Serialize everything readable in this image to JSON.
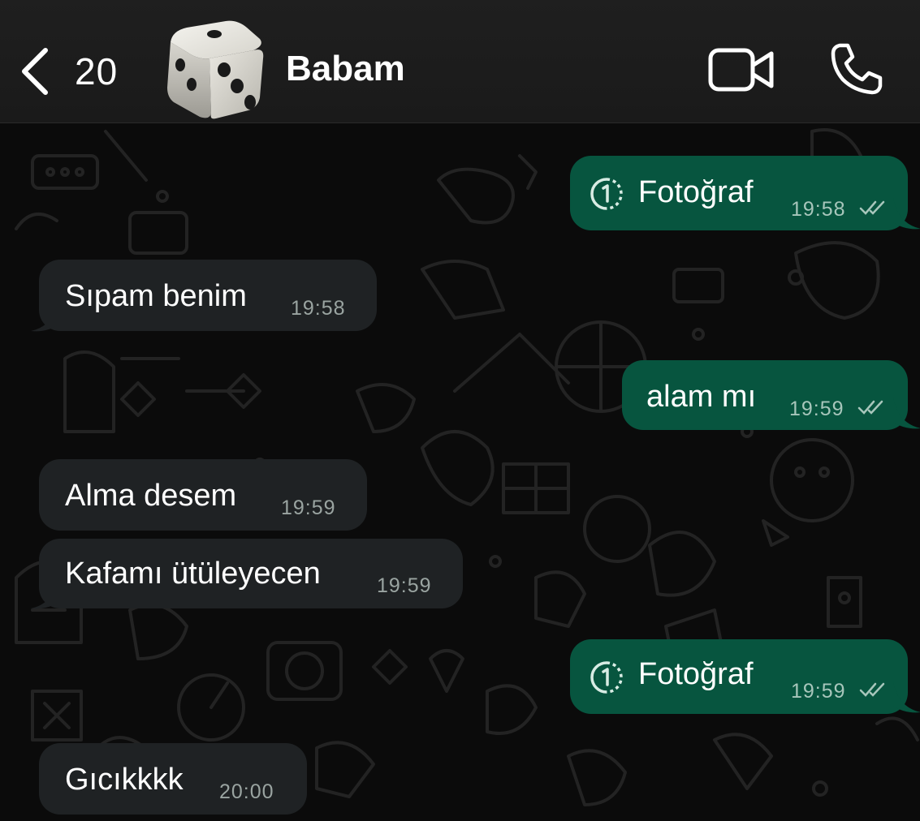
{
  "header": {
    "back_count": "20",
    "contact_name": "Babam"
  },
  "messages": [
    {
      "direction": "out",
      "kind": "photo",
      "text": "Fotoğraf",
      "time": "19:58",
      "status": "read"
    },
    {
      "direction": "in",
      "text": "Sıpam benim",
      "time": "19:58"
    },
    {
      "direction": "out",
      "text": "alam mı",
      "time": "19:59",
      "status": "read"
    },
    {
      "direction": "in",
      "text": "Alma desem",
      "time": "19:59"
    },
    {
      "direction": "in",
      "text": "Kafamı ütüleyecen",
      "time": "19:59"
    },
    {
      "direction": "out",
      "kind": "photo",
      "text": "Fotoğraf",
      "time": "19:59",
      "status": "read"
    },
    {
      "direction": "in",
      "text": "Gıcıkkkk",
      "time": "20:00"
    }
  ],
  "icons": {
    "back": "chevron-left-icon",
    "avatar": "dice-icon",
    "video": "video-camera-icon",
    "call": "phone-icon",
    "view_once": "view-once-photo-icon",
    "read": "double-check-icon"
  },
  "colors": {
    "incoming_bubble": "#1f2224",
    "outgoing_bubble": "#07553f",
    "background": "#0b0b0b"
  }
}
